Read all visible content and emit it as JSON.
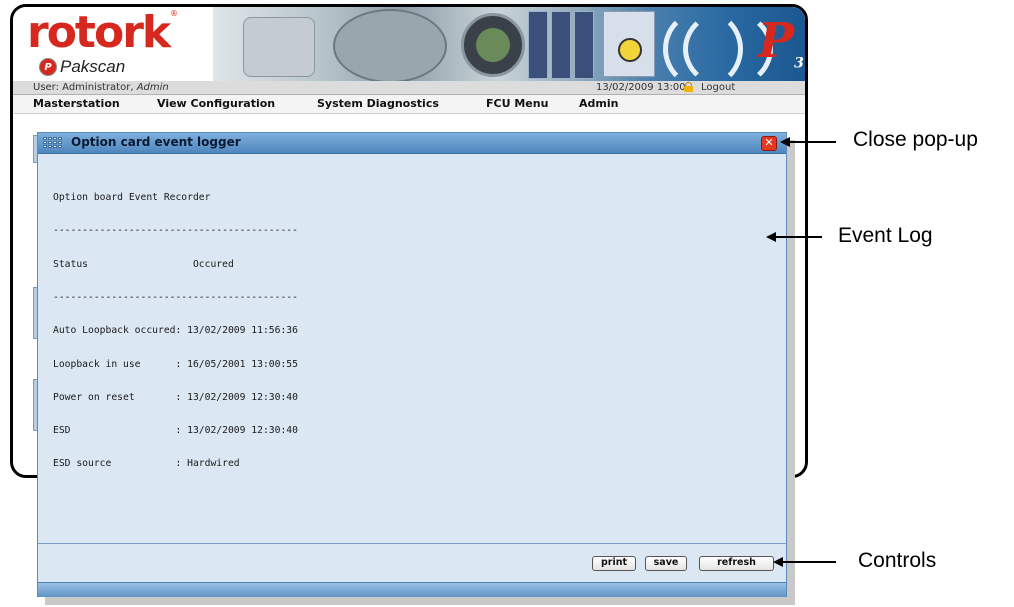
{
  "header": {
    "brand": "rotork",
    "brand_mark": "®",
    "product": "Pakscan",
    "product_icon_letter": "P",
    "badge": "P",
    "badge_sub": "3",
    "brand_color": "#d6281f"
  },
  "userbar": {
    "user_prefix": "User: Administrator, ",
    "user_role": "Admin",
    "datetime": "13/02/2009 13:00",
    "lock_icon": "lock-icon",
    "logout_label": "Logout"
  },
  "menu": {
    "items": [
      "Masterstation",
      "View Configuration",
      "System Diagnostics",
      "FCU Menu",
      "Admin"
    ]
  },
  "modal": {
    "title": "Option card event logger",
    "close_label": "✕",
    "log_lines": [
      "Option board Event Recorder",
      "------------------------------------------",
      "Status                  Occured",
      "------------------------------------------",
      "Auto Loopback occured: 13/02/2009 11:56:36",
      "Loopback in use      : 16/05/2001 13:00:55",
      "Power on reset       : 13/02/2009 12:30:40",
      "ESD                  : 13/02/2009 12:30:40",
      "ESD source           : Hardwired"
    ],
    "buttons": {
      "print": "print",
      "save": "save",
      "refresh": "refresh"
    }
  },
  "annotations": {
    "close": "Close pop-up",
    "event_log": "Event Log",
    "controls": "Controls"
  },
  "colors": {
    "title_bar": "#4f86bd",
    "modal_body": "#dbe7f2",
    "close_button": "#e53822"
  }
}
